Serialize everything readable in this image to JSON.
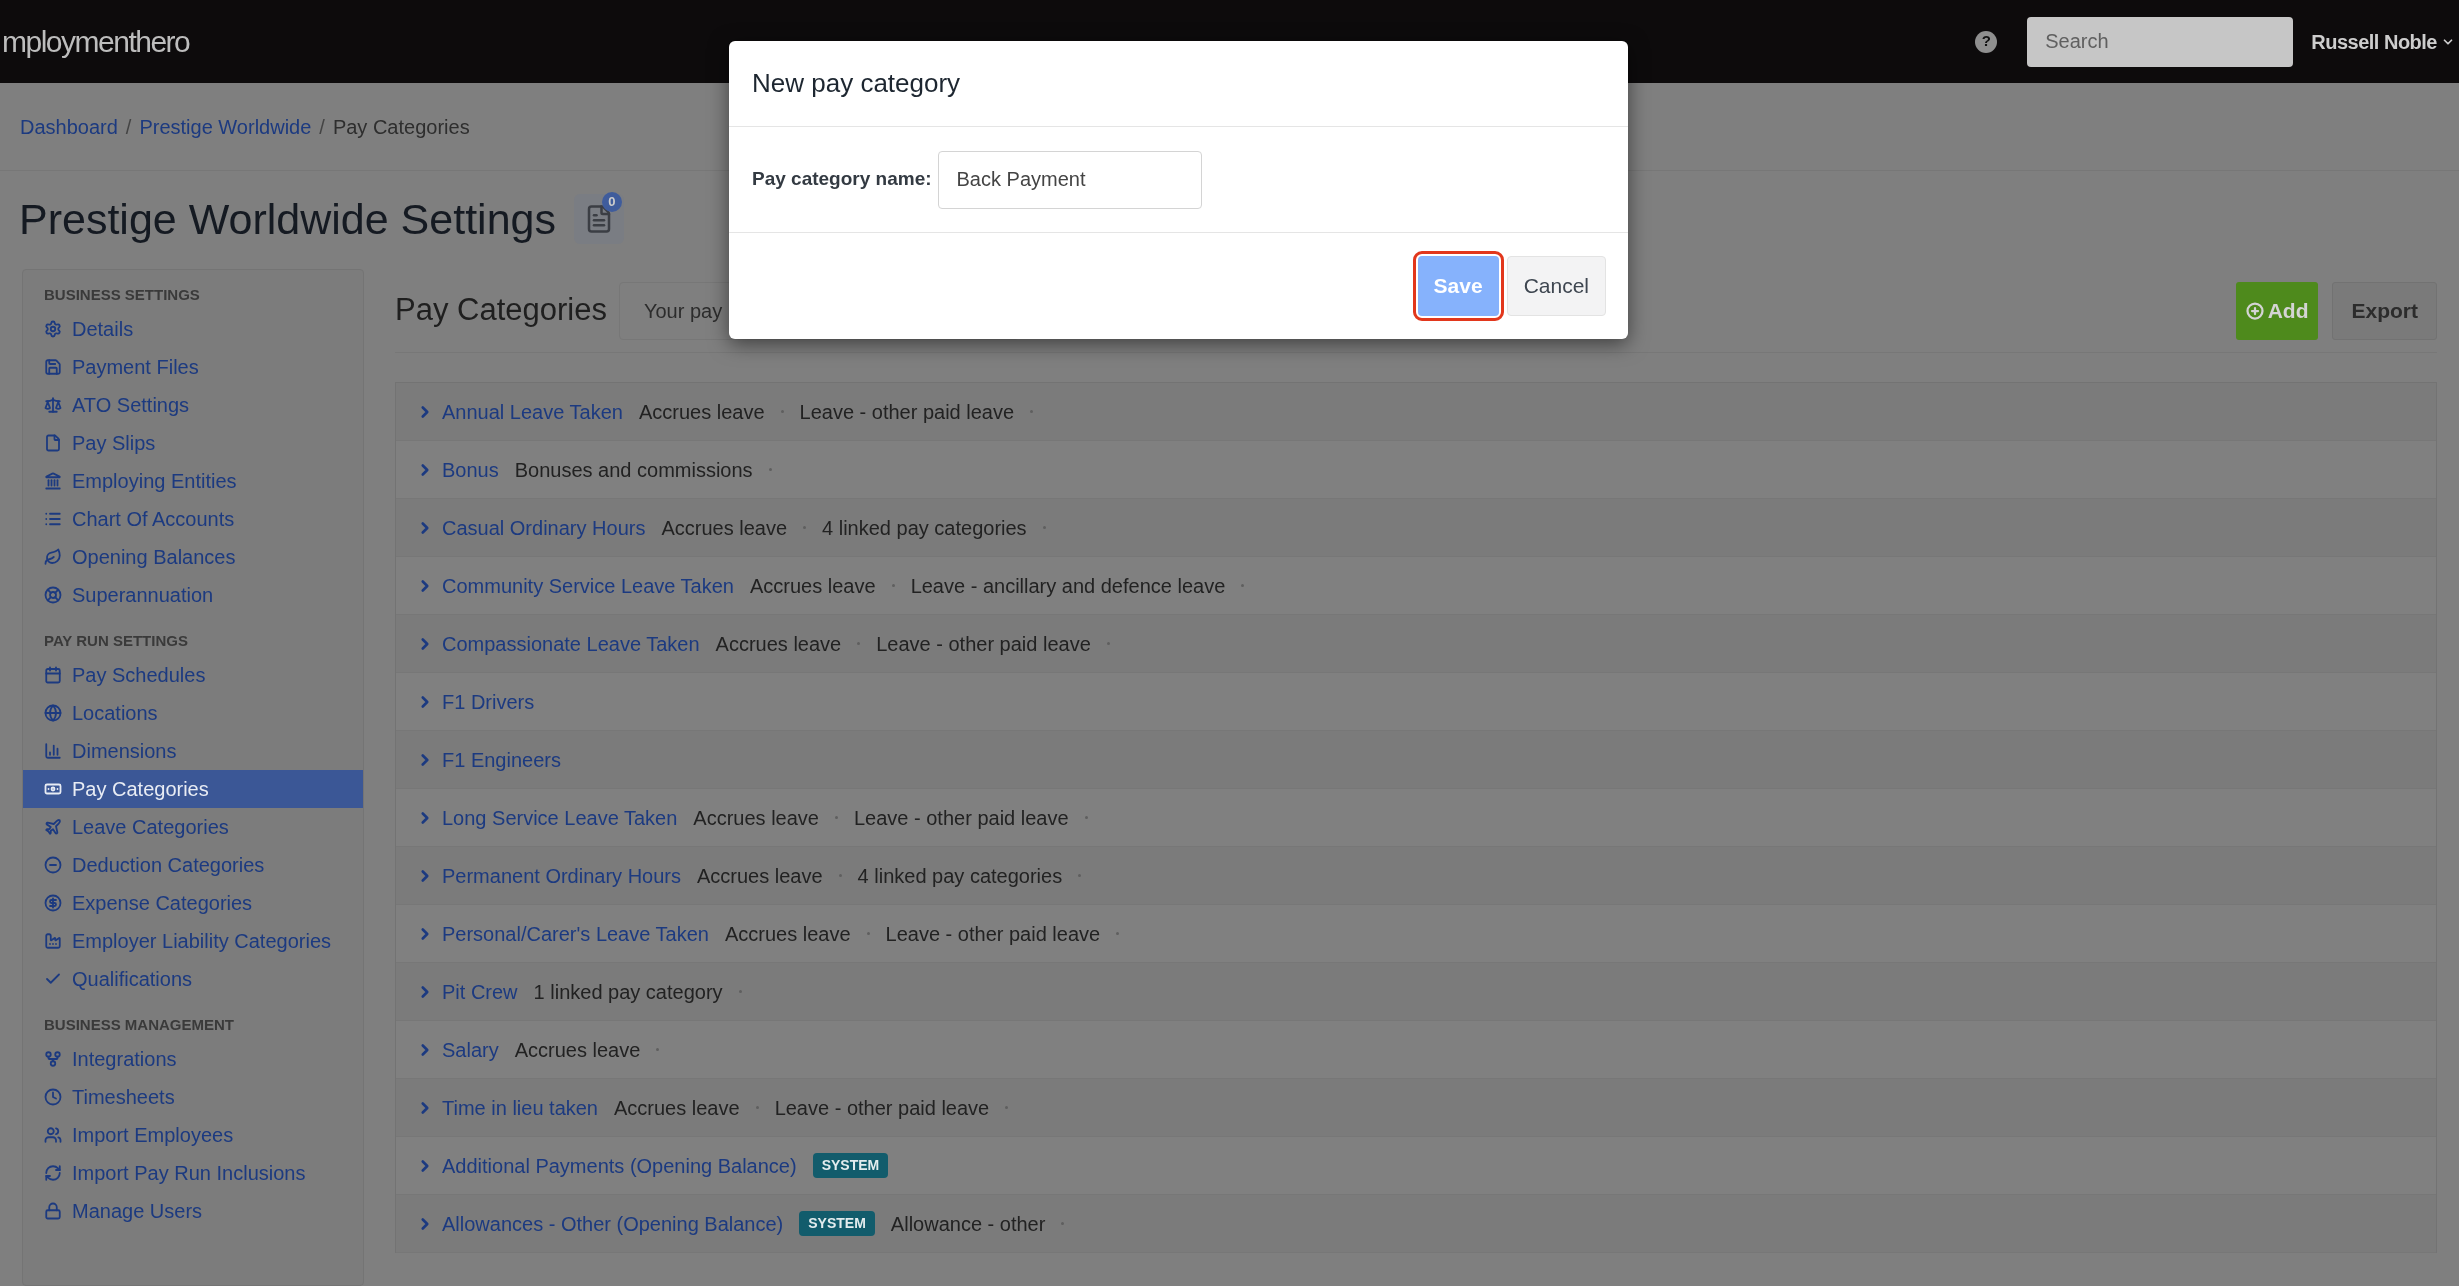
{
  "header": {
    "logo": "mploymenthero",
    "help": "?",
    "search": {
      "placeholder": "Search"
    },
    "user": "Russell Noble"
  },
  "breadcrumb_separator": "/",
  "breadcrumb": [
    {
      "label": "Dashboard",
      "kind": "link"
    },
    {
      "label": "Prestige Worldwide",
      "kind": "link"
    },
    {
      "label": "Pay Categories",
      "kind": "current"
    }
  ],
  "page_title": "Prestige Worldwide Settings",
  "notification_count": "0",
  "sidebar": {
    "sections": [
      {
        "heading": "BUSINESS SETTINGS",
        "items": [
          {
            "label": "Details",
            "selected": false
          },
          {
            "label": "Payment Files",
            "selected": false
          },
          {
            "label": "ATO Settings",
            "selected": false
          },
          {
            "label": "Pay Slips",
            "selected": false
          },
          {
            "label": "Employing Entities",
            "selected": false
          },
          {
            "label": "Chart Of Accounts",
            "selected": false
          },
          {
            "label": "Opening Balances",
            "selected": false
          },
          {
            "label": "Superannuation",
            "selected": false
          }
        ]
      },
      {
        "heading": "PAY RUN SETTINGS",
        "items": [
          {
            "label": "Pay Schedules",
            "selected": false
          },
          {
            "label": "Locations",
            "selected": false
          },
          {
            "label": "Dimensions",
            "selected": false
          },
          {
            "label": "Pay Categories",
            "selected": true
          },
          {
            "label": "Leave Categories",
            "selected": false
          },
          {
            "label": "Deduction Categories",
            "selected": false
          },
          {
            "label": "Expense Categories",
            "selected": false
          },
          {
            "label": "Employer Liability Categories",
            "selected": false
          },
          {
            "label": "Qualifications",
            "selected": false
          }
        ]
      },
      {
        "heading": "BUSINESS MANAGEMENT",
        "items": [
          {
            "label": "Integrations",
            "selected": false
          },
          {
            "label": "Timesheets",
            "selected": false
          },
          {
            "label": "Import Employees",
            "selected": false
          },
          {
            "label": "Import Pay Run Inclusions",
            "selected": false
          },
          {
            "label": "Manage Users",
            "selected": false
          }
        ]
      }
    ]
  },
  "content": {
    "title": "Pay Categories",
    "info_text": "Your pay",
    "buttons": [
      {
        "label": "Add",
        "kind": "primary"
      },
      {
        "label": "Export",
        "kind": "default"
      }
    ],
    "rows": [
      {
        "name": "Annual Leave Taken",
        "details": [
          "Accrues leave",
          "Leave - other paid leave"
        ]
      },
      {
        "name": "Bonus",
        "details": [
          "Bonuses and commissions"
        ]
      },
      {
        "name": "Casual Ordinary Hours",
        "details": [
          "Accrues leave",
          "4 linked pay categories"
        ]
      },
      {
        "name": "Community Service Leave Taken",
        "details": [
          "Accrues leave",
          "Leave - ancillary and defence leave"
        ]
      },
      {
        "name": "Compassionate Leave Taken",
        "details": [
          "Accrues leave",
          "Leave - other paid leave"
        ]
      },
      {
        "name": "F1 Drivers"
      },
      {
        "name": "F1 Engineers"
      },
      {
        "name": "Long Service Leave Taken",
        "details": [
          "Accrues leave",
          "Leave - other paid leave"
        ]
      },
      {
        "name": "Permanent Ordinary Hours",
        "details": [
          "Accrues leave",
          "4 linked pay categories"
        ]
      },
      {
        "name": "Personal/Carer's Leave Taken",
        "details": [
          "Accrues leave",
          "Leave - other paid leave"
        ]
      },
      {
        "name": "Pit Crew",
        "details": [
          "1 linked pay category"
        ]
      },
      {
        "name": "Salary",
        "details": [
          "Accrues leave"
        ]
      },
      {
        "name": "Time in lieu taken",
        "details": [
          "Accrues leave",
          "Leave - other paid leave"
        ]
      },
      {
        "name": "Additional Payments (Opening Balance)",
        "badge": "SYSTEM"
      },
      {
        "name": "Allowances - Other (Opening Balance)",
        "badge": "SYSTEM",
        "details": [
          "Allowance - other"
        ]
      }
    ]
  },
  "dialog": {
    "title": "New pay category",
    "field": {
      "label": "Pay category name:",
      "value": "Back Payment"
    },
    "buttons": [
      {
        "label": "Save",
        "kind": "primary",
        "focused": true
      },
      {
        "label": "Cancel",
        "kind": "default",
        "focused": false
      }
    ]
  }
}
